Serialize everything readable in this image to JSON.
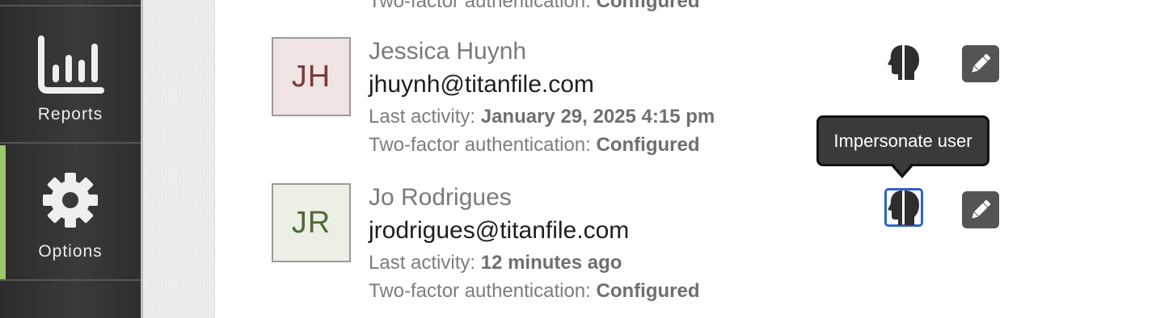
{
  "sidebar": {
    "items": [
      {
        "label": "Reports",
        "icon": "bar-chart-icon"
      },
      {
        "label": "Options",
        "icon": "gear-icon",
        "active": true
      }
    ]
  },
  "top_partial": {
    "twofa_label": "Two-factor authentication:",
    "twofa_value": "Configured"
  },
  "users": [
    {
      "initials": "JH",
      "name": "Jessica Huynh",
      "email": "jhuynh@titanfile.com",
      "last_activity_label": "Last activity:",
      "last_activity": "January 29, 2025 4:15 pm",
      "twofa_label": "Two-factor authentication:",
      "twofa_value": "Configured",
      "avatar_bg": "#efe3e3",
      "avatar_color": "#7a3a3a"
    },
    {
      "initials": "JR",
      "name": "Jo Rodrigues",
      "email": "jrodrigues@titanfile.com",
      "last_activity_label": "Last activity:",
      "last_activity": "12 minutes ago",
      "twofa_label": "Two-factor authentication:",
      "twofa_value": "Configured",
      "avatar_bg": "#ecefe6",
      "avatar_color": "#4f6a34"
    }
  ],
  "tooltip": {
    "text": "Impersonate user"
  },
  "colors": {
    "sidebar_bg": "#333333",
    "active_accent": "#9bc96a",
    "focus_ring": "#2f63c8",
    "edit_button_bg": "#545454"
  }
}
